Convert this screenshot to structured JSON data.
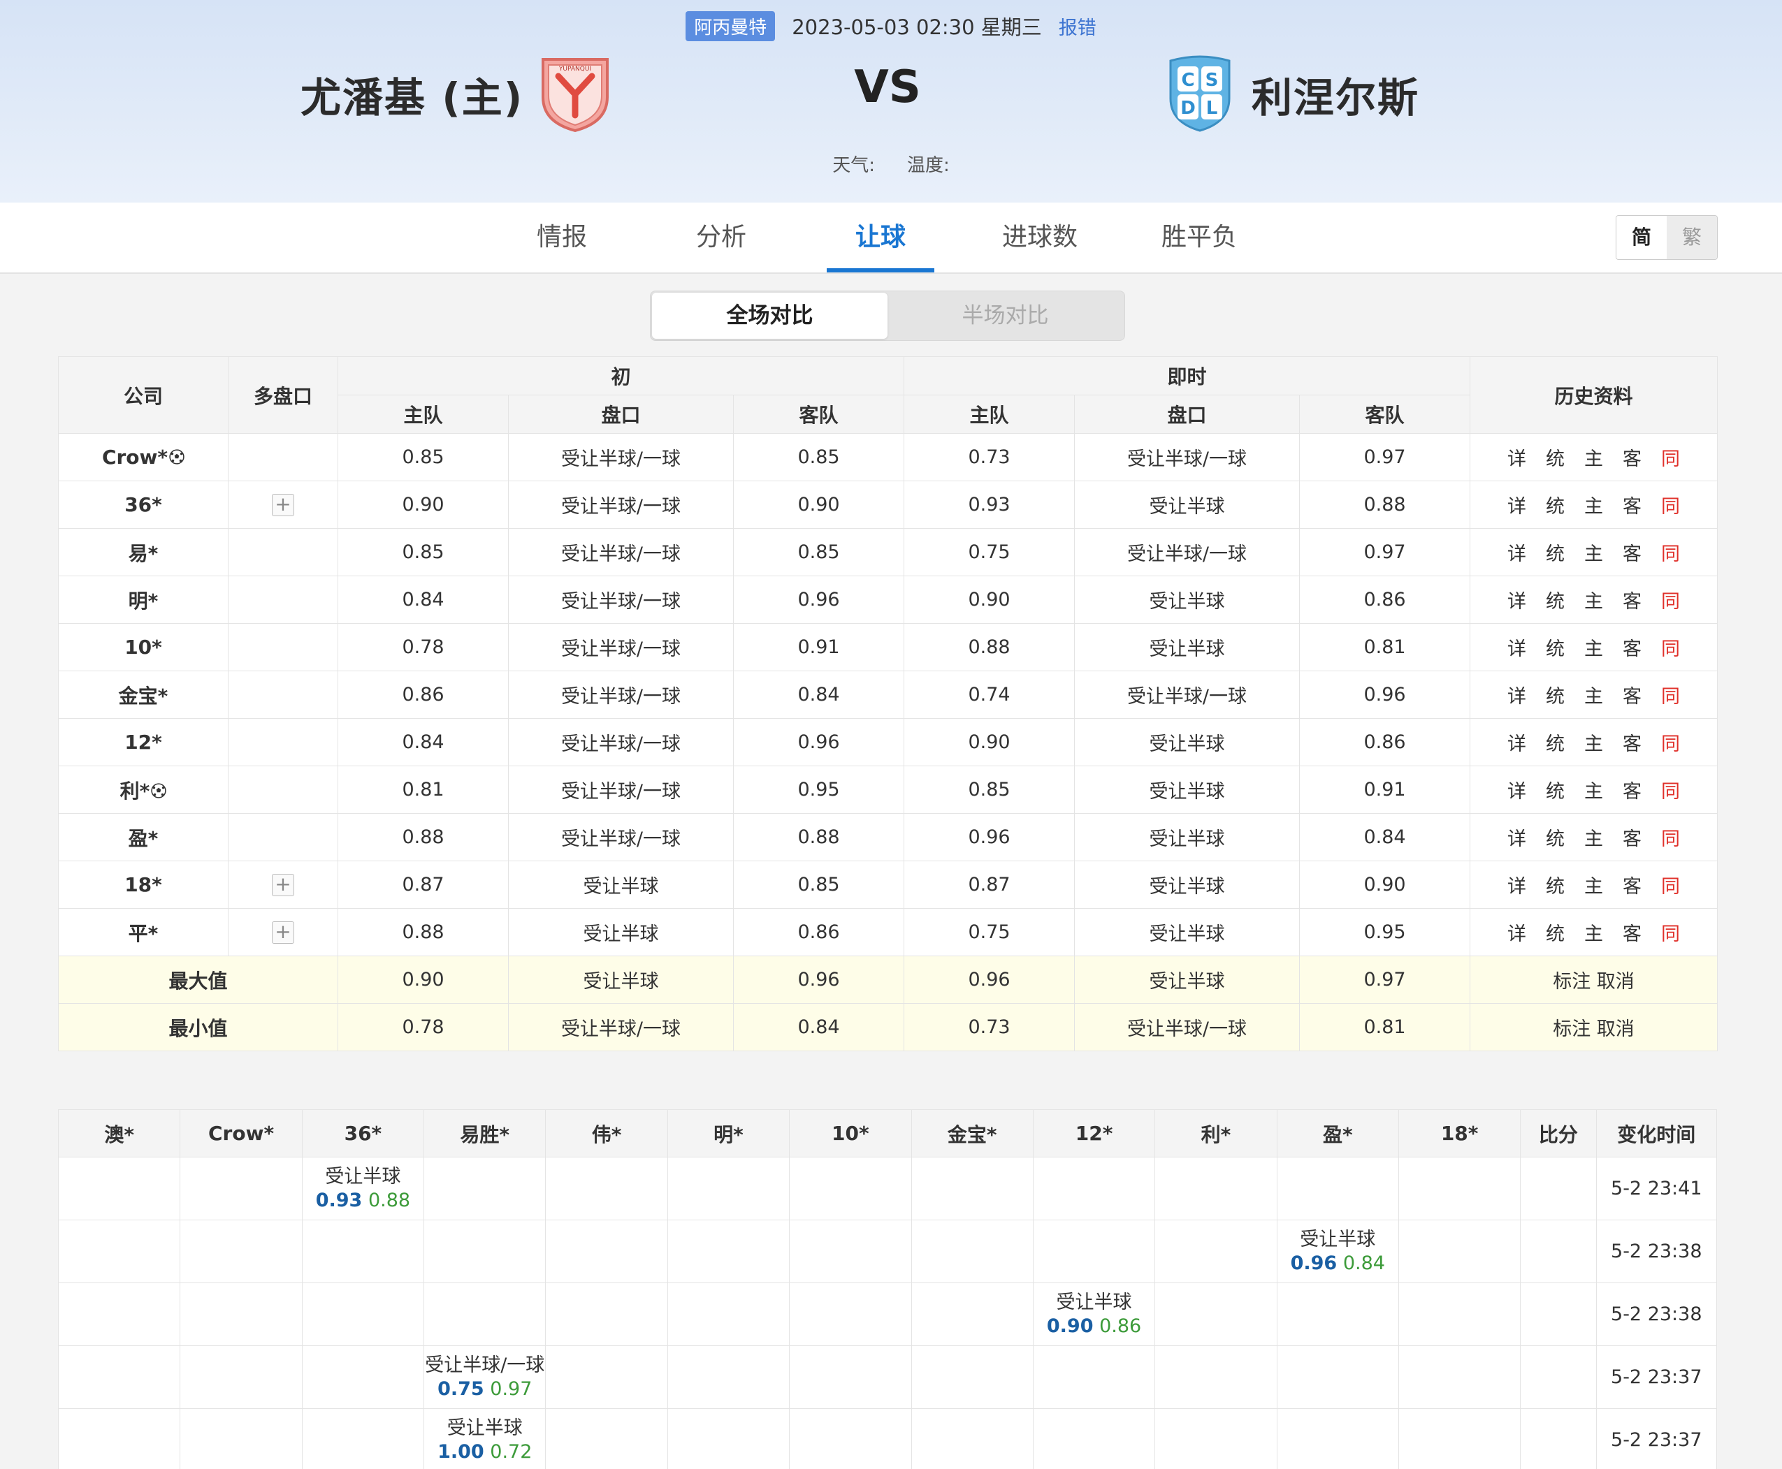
{
  "header": {
    "league": "阿丙曼特",
    "datetime": "2023-05-03 02:30 星期三",
    "report": "报错",
    "home_team": "尤潘基 (主)",
    "away_team": "利涅尔斯",
    "vs": "VS",
    "home_logo_text": "YUPANQUI",
    "away_logo_letters": [
      "C",
      "S",
      "D",
      "L"
    ],
    "weather_label": "天气:",
    "temperature_label": "温度:"
  },
  "nav": {
    "tabs": [
      "情报",
      "分析",
      "让球",
      "进球数",
      "胜平负"
    ],
    "active_tab": "让球",
    "lang_simplified": "简",
    "lang_traditional": "繁"
  },
  "scope": {
    "full": "全场对比",
    "half": "半场对比"
  },
  "odds_table": {
    "headers": {
      "company": "公司",
      "multi": "多盘口",
      "initial": "初",
      "live": "即时",
      "history": "历史资料",
      "home": "主队",
      "line": "盘口",
      "away": "客队"
    },
    "history_links": [
      "详",
      "统",
      "主",
      "客",
      "同"
    ],
    "rows": [
      {
        "company": "Crow*",
        "ball": true,
        "plus": false,
        "i_home": "0.85",
        "i_line": "受让半球/一球",
        "i_away": "0.85",
        "l_home": "0.73",
        "l_line": "受让半球/一球",
        "l_away": "0.97"
      },
      {
        "company": "36*",
        "ball": false,
        "plus": true,
        "i_home": "0.90",
        "i_line": "受让半球/一球",
        "i_away": "0.90",
        "l_home": "0.93",
        "l_line": "受让半球",
        "l_away": "0.88"
      },
      {
        "company": "易*",
        "ball": false,
        "plus": false,
        "i_home": "0.85",
        "i_line": "受让半球/一球",
        "i_away": "0.85",
        "l_home": "0.75",
        "l_line": "受让半球/一球",
        "l_away": "0.97"
      },
      {
        "company": "明*",
        "ball": false,
        "plus": false,
        "i_home": "0.84",
        "i_line": "受让半球/一球",
        "i_away": "0.96",
        "l_home": "0.90",
        "l_line": "受让半球",
        "l_away": "0.86"
      },
      {
        "company": "10*",
        "ball": false,
        "plus": false,
        "i_home": "0.78",
        "i_line": "受让半球/一球",
        "i_away": "0.91",
        "l_home": "0.88",
        "l_line": "受让半球",
        "l_away": "0.81"
      },
      {
        "company": "金宝*",
        "ball": false,
        "plus": false,
        "i_home": "0.86",
        "i_line": "受让半球/一球",
        "i_away": "0.84",
        "l_home": "0.74",
        "l_line": "受让半球/一球",
        "l_away": "0.96"
      },
      {
        "company": "12*",
        "ball": false,
        "plus": false,
        "i_home": "0.84",
        "i_line": "受让半球/一球",
        "i_away": "0.96",
        "l_home": "0.90",
        "l_line": "受让半球",
        "l_away": "0.86"
      },
      {
        "company": "利*",
        "ball": true,
        "plus": false,
        "i_home": "0.81",
        "i_line": "受让半球/一球",
        "i_away": "0.95",
        "l_home": "0.85",
        "l_line": "受让半球",
        "l_away": "0.91"
      },
      {
        "company": "盈*",
        "ball": false,
        "plus": false,
        "i_home": "0.88",
        "i_line": "受让半球/一球",
        "i_away": "0.88",
        "l_home": "0.96",
        "l_line": "受让半球",
        "l_away": "0.84"
      },
      {
        "company": "18*",
        "ball": false,
        "plus": true,
        "i_home": "0.87",
        "i_line": "受让半球",
        "i_away": "0.85",
        "l_home": "0.87",
        "l_line": "受让半球",
        "l_away": "0.90"
      },
      {
        "company": "平*",
        "ball": false,
        "plus": true,
        "i_home": "0.88",
        "i_line": "受让半球",
        "i_away": "0.86",
        "l_home": "0.75",
        "l_line": "受让半球",
        "l_away": "0.95"
      }
    ],
    "max_row": {
      "label": "最大值",
      "i_home": "0.90",
      "i_line": "受让半球",
      "i_away": "0.96",
      "l_home": "0.96",
      "l_line": "受让半球",
      "l_away": "0.97",
      "action": "标注 取消"
    },
    "min_row": {
      "label": "最小值",
      "i_home": "0.78",
      "i_line": "受让半球/一球",
      "i_away": "0.84",
      "l_home": "0.73",
      "l_line": "受让半球/一球",
      "l_away": "0.81",
      "action": "标注 取消"
    }
  },
  "changes_table": {
    "headers": [
      "澳*",
      "Crow*",
      "36*",
      "易胜*",
      "伟*",
      "明*",
      "10*",
      "金宝*",
      "12*",
      "利*",
      "盈*",
      "18*",
      "比分",
      "变化时间"
    ],
    "rows": [
      {
        "col": 2,
        "line": "受让半球",
        "home": "0.93",
        "away": "0.88",
        "time": "5-2 23:41"
      },
      {
        "col": 10,
        "line": "受让半球",
        "home": "0.96",
        "away": "0.84",
        "time": "5-2 23:38"
      },
      {
        "col": 8,
        "line": "受让半球",
        "home": "0.90",
        "away": "0.86",
        "time": "5-2 23:38"
      },
      {
        "col": 3,
        "line": "受让半球/一球",
        "home": "0.75",
        "away": "0.97",
        "time": "5-2 23:37"
      },
      {
        "col": 3,
        "line": "受让半球",
        "home": "1.00",
        "away": "0.72",
        "time": "5-2 23:37"
      }
    ]
  },
  "colors": {
    "accent": "#1976d2",
    "same_link": "#e0302a",
    "odds_home": "#1a5fa3",
    "odds_away": "#3d9b3a",
    "summary_bg": "#fefde8"
  }
}
